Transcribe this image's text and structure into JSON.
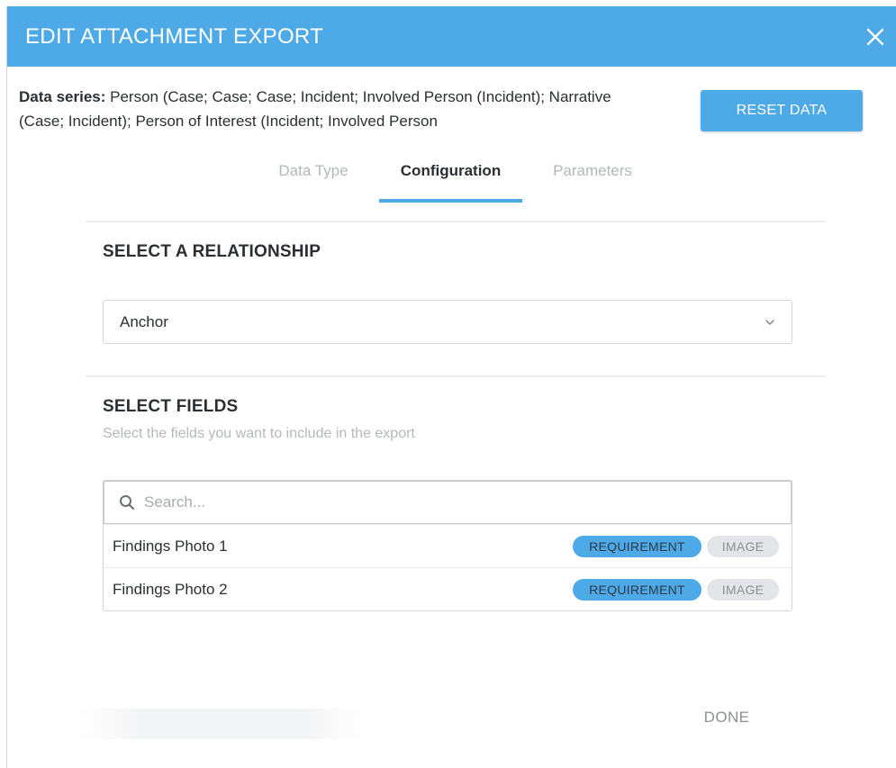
{
  "dialog": {
    "title": "EDIT ATTACHMENT EXPORT",
    "close_icon": "close-icon",
    "accent_color": "#4eaae7"
  },
  "data_series": {
    "label": "Data series:",
    "value": " Person (Case; Case; Case; Incident; Involved Person (Incident); Narrative (Case; Incident); Person of Interest (Incident; Involved Person"
  },
  "reset_button": {
    "label": "RESET DATA"
  },
  "tabs": [
    {
      "label": "Data Type",
      "active": false
    },
    {
      "label": "Configuration",
      "active": true
    },
    {
      "label": "Parameters",
      "active": false
    }
  ],
  "relationship": {
    "title": "SELECT A RELATIONSHIP",
    "selected": "Anchor",
    "icon": "chevron-down-icon"
  },
  "fields": {
    "title": "SELECT FIELDS",
    "subtitle": "Select the fields you want to include in the export",
    "search_placeholder": "Search...",
    "search_value": "",
    "search_icon": "search-icon",
    "items": [
      {
        "name": "Findings Photo 1",
        "badges": [
          "REQUIREMENT",
          "IMAGE"
        ]
      },
      {
        "name": "Findings Photo 2",
        "badges": [
          "REQUIREMENT",
          "IMAGE"
        ]
      }
    ]
  },
  "footer": {
    "done_label": "DONE"
  }
}
